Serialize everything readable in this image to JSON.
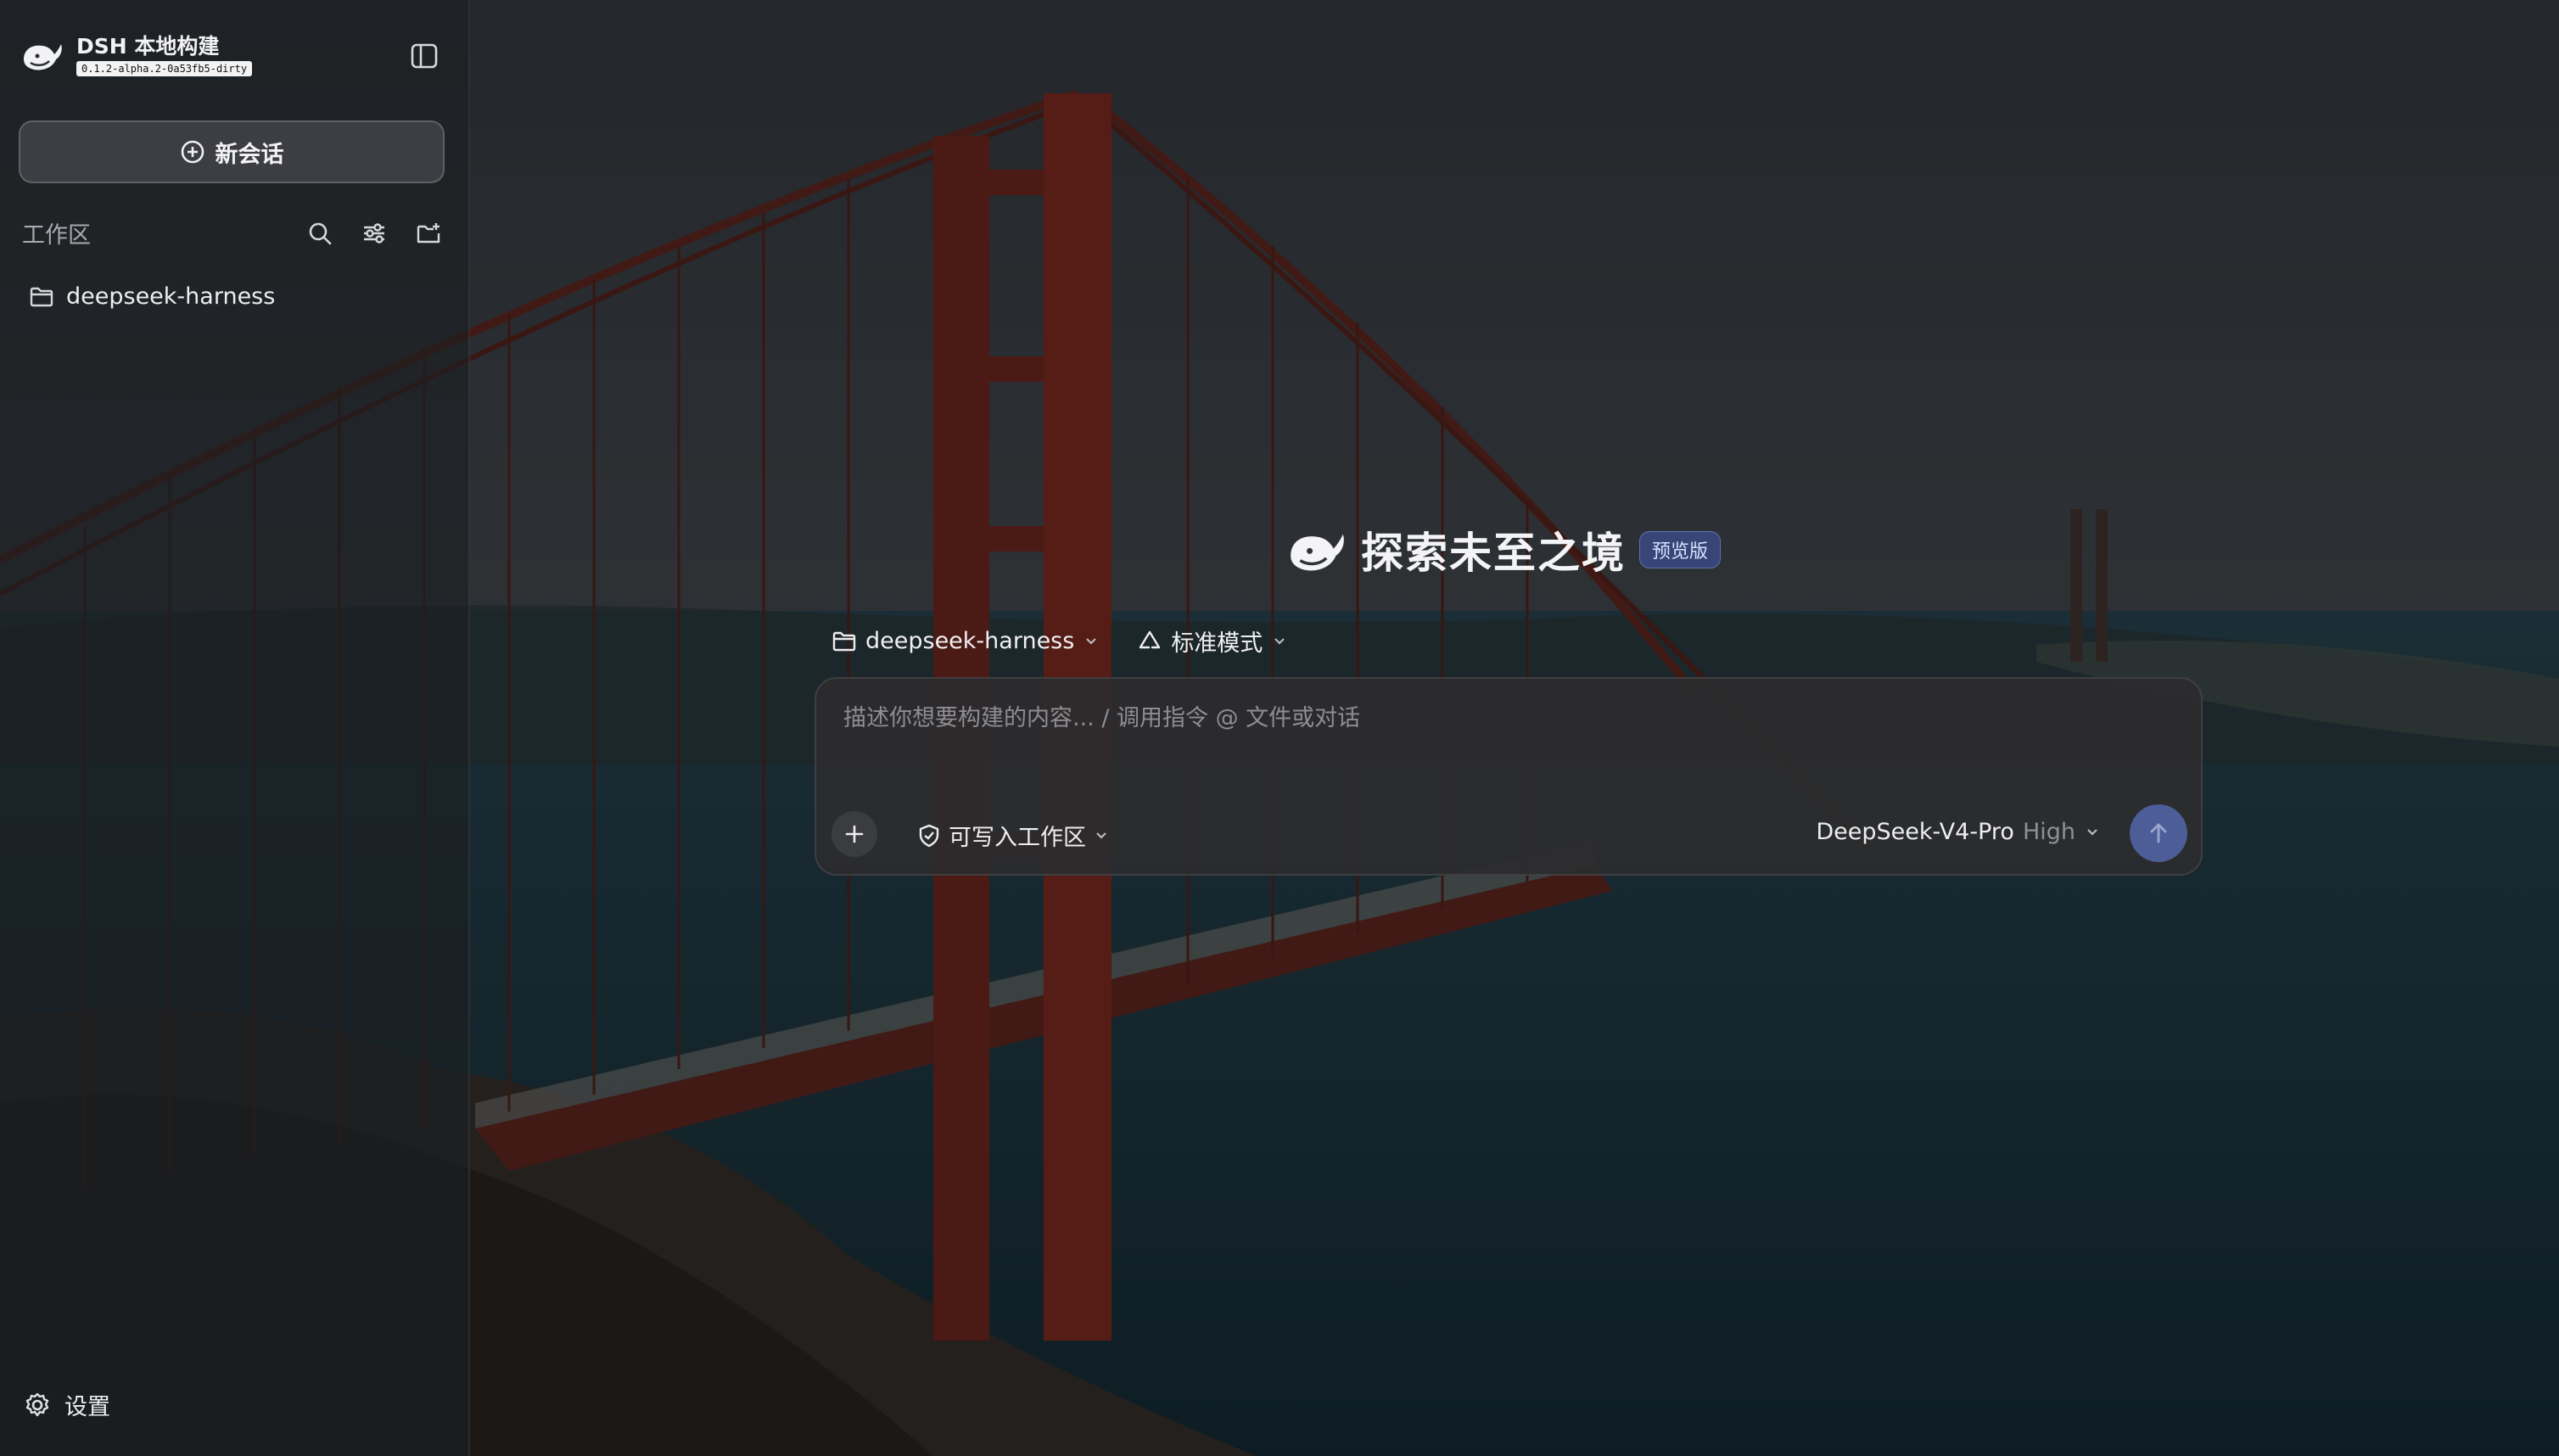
{
  "sidebar": {
    "brand": {
      "title": "DSH 本地构建",
      "version": "0.1.2-alpha.2-0a53fb5-dirty"
    },
    "new_chat_label": "新会话",
    "workspace": {
      "label": "工作区",
      "items": [
        {
          "label": "deepseek-harness"
        }
      ]
    },
    "settings_label": "设置"
  },
  "main": {
    "hero": {
      "title": "探索未至之境",
      "badge": "预览版"
    },
    "selectors": {
      "project": "deepseek-harness",
      "mode": "标准模式"
    },
    "composer": {
      "placeholder": "描述你想要构建的内容... / 调用指令 @ 文件或对话",
      "permission": "可写入工作区",
      "model_name": "DeepSeek-V4-Pro",
      "model_level": "High"
    }
  },
  "icons": {
    "logo": "whale-icon",
    "collapse": "sidebar-toggle-icon",
    "new_chat": "plus-circle-icon",
    "search": "search-icon",
    "filter": "sliders-icon",
    "new_folder": "folder-plus-icon",
    "folder": "folder-icon",
    "settings": "gear-icon",
    "mode": "recycle-icon",
    "attach": "plus-icon",
    "permission": "shield-icon",
    "send": "arrow-up-icon",
    "dropdown": "chevron-down-icon"
  },
  "colors": {
    "accent_send": "#4c5d97",
    "badge_bg": "#3a4a84"
  }
}
